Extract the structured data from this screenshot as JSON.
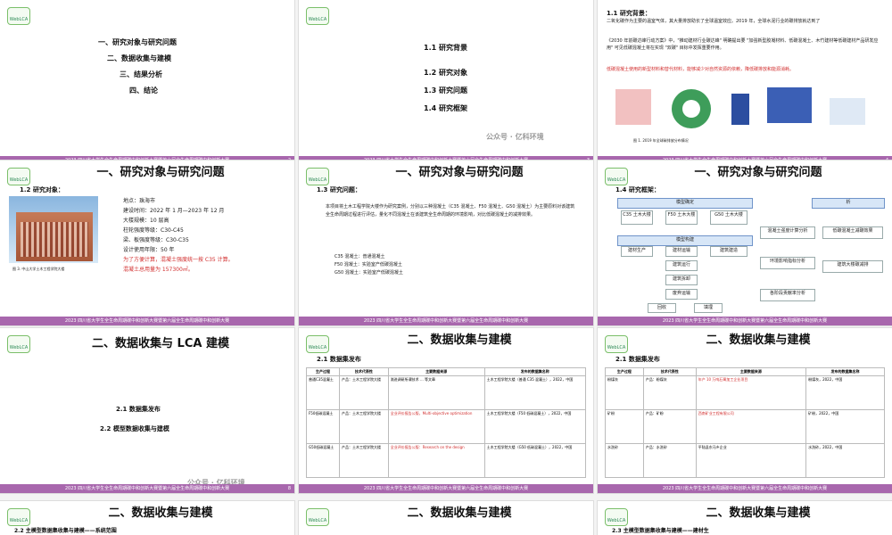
{
  "slides": {
    "s1": {
      "title": "一、研究对象与研究问题",
      "items": [
        "一、研究对象与研究问题",
        "二、数据收集与建模",
        "三、结果分析",
        "四、结论"
      ],
      "page": "2"
    },
    "s2": {
      "title": "一、研究对象与研究问题",
      "items": [
        "1.1 研究背景",
        "1.2 研究对象",
        "1.3 研究问题",
        "1.4 研究框架"
      ],
      "page": "3"
    },
    "s3": {
      "heading": "1.1 研究背景：",
      "text1": "二氧化碳作为主要的温室气体，其大量排放助长了全球温室效应。2019 年，全球水泥行业的碳排放就达到了",
      "text2": "《2030 年前碳达峰行动方案》中，\"推动建材行业碳达峰\" 明确提出要 \"加强新型胶凝材料、低碳混凝土、木竹建材等低碳建材产品研发应用\" 可见低碳混凝土将在实现 \"双碳\" 目标中发挥重要作用。",
      "text3": "低碳混凝土使用的新型材料和替代材料，能够减少对自然资源的依赖，降低碳排放和能源消耗。",
      "caption": "图 1. 2019 年全球碳排放分布情况",
      "page": "4"
    },
    "s4": {
      "title": "一、研究对象与研究问题",
      "heading": "1.2 研究对象：",
      "lines": [
        "地点：珠海市",
        "建设时间：2022 年 1 月—2023 年 12 月",
        "大楼规模：10 层高",
        "柱轮强度等级：C30-C45",
        "梁、板强度等级：C30-C35",
        "设计使用年限：50 年"
      ],
      "red1": "为了方便计算，混凝土强度统一按 C35 计算。",
      "red2": "混凝土总用量为 157300㎡。",
      "caption": "图 3. 中山大学土木工程学院大楼",
      "page": "5"
    },
    "s5": {
      "title": "一、研究对象与研究问题",
      "heading": "1.3 研究问题：",
      "para": "本项目将土木工程学院大楼作为研究案例，分别以三种混凝土（C35 混凝土、F50 混凝土、G50 混凝土）为主要原料对该建筑全生命周期过程进行评估，量化不同混凝土在该建筑全生命周期的环境影响，对比低碳混凝土的减排效果。",
      "list": [
        "C35 混凝土：普通混凝土",
        "F50 混凝土：实验室产低碳混凝土",
        "G50 混凝土：实验室产低碳混凝土"
      ],
      "page": "6"
    },
    "s6": {
      "title": "一、研究对象与研究问题",
      "heading": "1.4 研究框架：",
      "nodes": [
        "模型确定",
        "C35 土木大楼",
        "F50 土木大楼",
        "G50 土木大楼",
        "模型构建",
        "建材生产",
        "建材运输",
        "建筑建造",
        "建筑运行",
        "建筑拆卸",
        "废弃运输",
        "回收",
        "填埋",
        "混凝土强度计算分析",
        "低碳混凝土减碳效果",
        "环境影响指标分析",
        "建筑大楼碳减排",
        "各阶段贡献率分析",
        "析"
      ],
      "page": "7"
    },
    "s7": {
      "title": "二、数据收集与 LCA 建模",
      "items": [
        "2.1 数据集发布",
        "2.2 模型数据收集与建模"
      ],
      "page": "8"
    },
    "s8": {
      "title": "二、数据收集与建模",
      "heading": "2.1 数据集发布",
      "cols": [
        "生产过程",
        "技术代表性",
        "主要数据来源",
        "发布的数据集名称"
      ],
      "rows": [
        [
          "普通C35混凝土",
          "产品：土木工程学院大楼",
          "渐进调研所谓技术 ... 等文章",
          "土木工程学院大楼（普通 C35 混凝土），2022，中国"
        ],
        [
          "F50低碳混凝土",
          "产品：土木工程学院大楼",
          "全业评价报告公版，Multi-objective optimization",
          "土木工程学院大楼（F50 低碳混凝土），2022，中国"
        ],
        [
          "G50低碳混凝土",
          "产品：土木工程学院大楼",
          "全业评价报告公版：Research on the design",
          "土木工程学院大楼（G50 低碳混凝土），2022，中国"
        ]
      ],
      "page": "9"
    },
    "s9": {
      "title": "二、数据收集与建模",
      "heading": "2.1 数据集发布",
      "cols": [
        "生产过程",
        "技术代表性",
        "主要数据来源",
        "发布的数据集名称"
      ],
      "rows": [
        [
          "粉煤灰",
          "产品：粉煤灰",
          "年产 10 万吨石膏加工企业项目",
          "粉煤灰，2022，中国"
        ],
        [
          "矿粉",
          "产品：矿粉",
          "西南矿业工程有限公司",
          "矿粉，2022，中国"
        ],
        [
          "水洗砂",
          "产品：水洗砂",
          "平陆县东马乡企业",
          "水洗砂，2022，中国"
        ]
      ],
      "page": "10"
    },
    "s10": {
      "title": "二、数据收集与建模",
      "heading": "2.2 主模型数据集收集与建模——系统范围"
    },
    "s11": {
      "title": "二、数据收集与建模"
    },
    "s12": {
      "title": "二、数据收集与建模",
      "heading": "2.3 主模型数据集收集与建模——建材生"
    },
    "footer": "2023 四川省大学生全生命周期碳中和创新大赛暨第六届全生命周期碳中和创新大赛",
    "watermark": "公众号 · 亿科环境",
    "logo": "WebLCA"
  }
}
